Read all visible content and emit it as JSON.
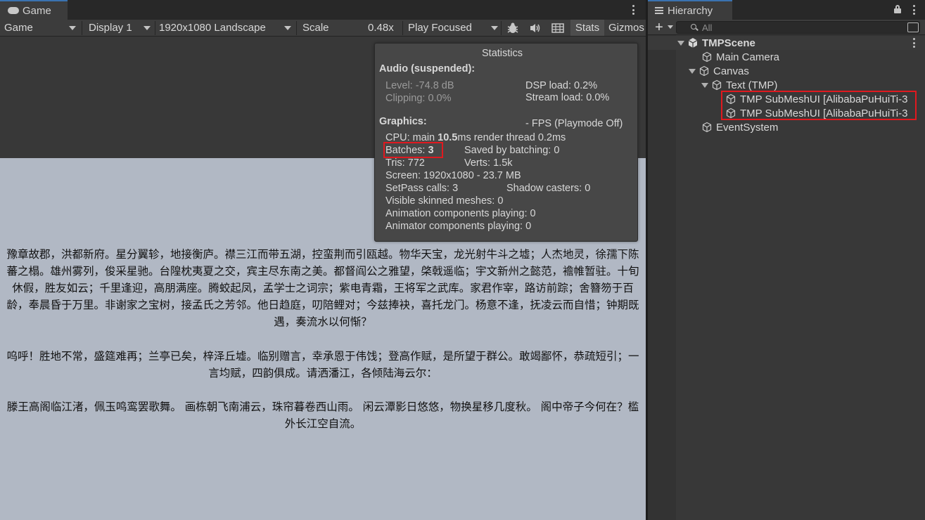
{
  "game_panel": {
    "tab_title": "Game",
    "toolbar": {
      "view_mode": "Game",
      "display": "Display 1",
      "resolution": "1920x1080 Landscape",
      "scale_label": "Scale",
      "scale_value": "0.48x",
      "scale_slider_fraction": 0.0,
      "play_mode": "Play Focused",
      "stats_label": "Stats",
      "gizmos_label": "Gizmos"
    },
    "text_paragraphs": [
      "豫章故郡，洪都新府。星分翼轸，地接衡庐。襟三江而带五湖，控蛮荆而引瓯越。物华天宝，龙光射牛斗之墟；人杰地灵，徐孺下陈蕃之榻。雄州雾列，俊采星驰。台隍枕夷夏之交，宾主尽东南之美。都督阎公之雅望，棨戟遥临；宇文新州之懿范，襜帷暂驻。十旬休假，胜友如云；千里逢迎，高朋满座。腾蛟起凤，孟学士之词宗；紫电青霜，王将军之武库。家君作宰，路访前踪；舍簪笏于百龄，奉晨昏于万里。非谢家之宝树，接孟氏之芳邻。他日趋庭，叨陪鲤对；今兹捧袂，喜托龙门。杨意不逢，抚凌云而自惜；钟期既遇，奏流水以何惭？",
      "呜呼！胜地不常，盛筵难再；兰亭已矣，梓泽丘墟。临别赠言，幸承恩于伟饯；登高作赋，是所望于群公。敢竭鄙怀，恭疏短引；一言均赋，四韵俱成。请洒潘江，各倾陆海云尔：",
      "滕王高阁临江渚，佩玉鸣鸾罢歌舞。 画栋朝飞南浦云，珠帘暮卷西山雨。 闲云潭影日悠悠，物换星移几度秋。 阁中帝子今何在？槛外长江空自流。"
    ]
  },
  "statistics": {
    "title": "Statistics",
    "audio_header": "Audio (suspended):",
    "level": "Level: -74.8 dB",
    "clipping": "Clipping: 0.0%",
    "dsp_load": "DSP load: 0.2%",
    "stream_load": "Stream load: 0.0%",
    "graphics_header": "Graphics:",
    "fps": "- FPS (Playmode Off)",
    "cpu_prefix": "CPU: main ",
    "cpu_main": "10.5",
    "cpu_suffix": "ms  render thread 0.2ms",
    "batches_prefix": "Batches: ",
    "batches_value": "3",
    "saved_by_batching": "Saved by batching: 0",
    "tris": "Tris: 772",
    "verts": "Verts: 1.5k",
    "screen": "Screen: 1920x1080 - 23.7 MB",
    "setpass": "SetPass calls: 3",
    "shadow_casters": "Shadow casters: 0",
    "skinned_meshes": "Visible skinned meshes: 0",
    "animation_components": "Animation components playing: 0",
    "animator_components": "Animator components playing: 0"
  },
  "hierarchy": {
    "tab_title": "Hierarchy",
    "search_placeholder": "All",
    "scene_name": "TMPScene",
    "items": [
      {
        "label": "Main Camera"
      },
      {
        "label": "Canvas"
      },
      {
        "label": "Text (TMP)"
      },
      {
        "label": "TMP SubMeshUI [AlibabaPuHuiTi-3"
      },
      {
        "label": "TMP SubMeshUI [AlibabaPuHuiTi-3"
      },
      {
        "label": "EventSystem"
      }
    ]
  },
  "colors": {
    "accent_tab": "#3a72b0",
    "highlight": "#e0191f",
    "game_view_bg": "#b1b8c4"
  }
}
